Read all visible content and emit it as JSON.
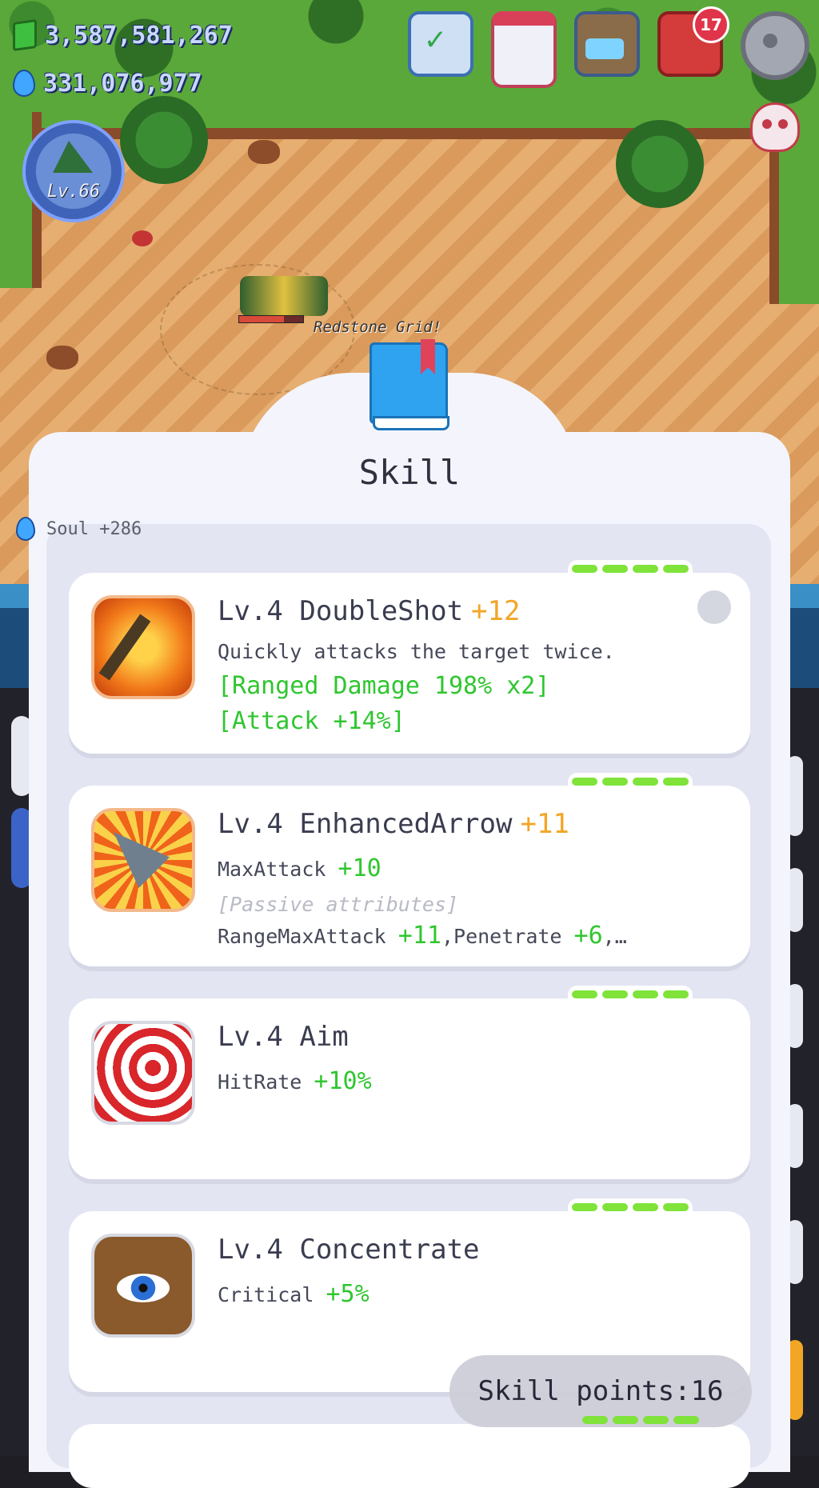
{
  "hud": {
    "gems": "3,587,581,267",
    "souls": "331,076,977",
    "level": "Lv.66",
    "mail_badge": "17",
    "player_name": "Redstone Grid!"
  },
  "panel": {
    "title": "Skill",
    "soul_gain": "Soul +286",
    "skill_points": "Skill points:16"
  },
  "skills": [
    {
      "name": "Lv.4 DoubleShot",
      "bonus": "+12",
      "desc": "Quickly attacks the target twice.",
      "line1": "[Ranged Damage 198% x2]",
      "line2": "[Attack +14%]",
      "icon": "doubleshot-icon"
    },
    {
      "name": "Lv.4 EnhancedArrow",
      "bonus": "+11",
      "stat_label": "MaxAttack",
      "stat_value": "+10",
      "passive": "[Passive attributes]",
      "p1_label": "RangeMaxAttack",
      "p1_value": "+11",
      "p2_label": ",Penetrate",
      "p2_value": "+6",
      "p_more": ",…",
      "icon": "enhanced-arrow-icon"
    },
    {
      "name": "Lv.4 Aim",
      "stat_label": "HitRate",
      "stat_value": "+10%",
      "icon": "target-icon"
    },
    {
      "name": "Lv.4 Concentrate",
      "stat_label": "Critical",
      "stat_value": "+5%",
      "icon": "eye-icon"
    }
  ],
  "colors": {
    "accent_green": "#2fc62f",
    "bonus_orange": "#f3a526",
    "pip_green": "#7fe33a"
  }
}
